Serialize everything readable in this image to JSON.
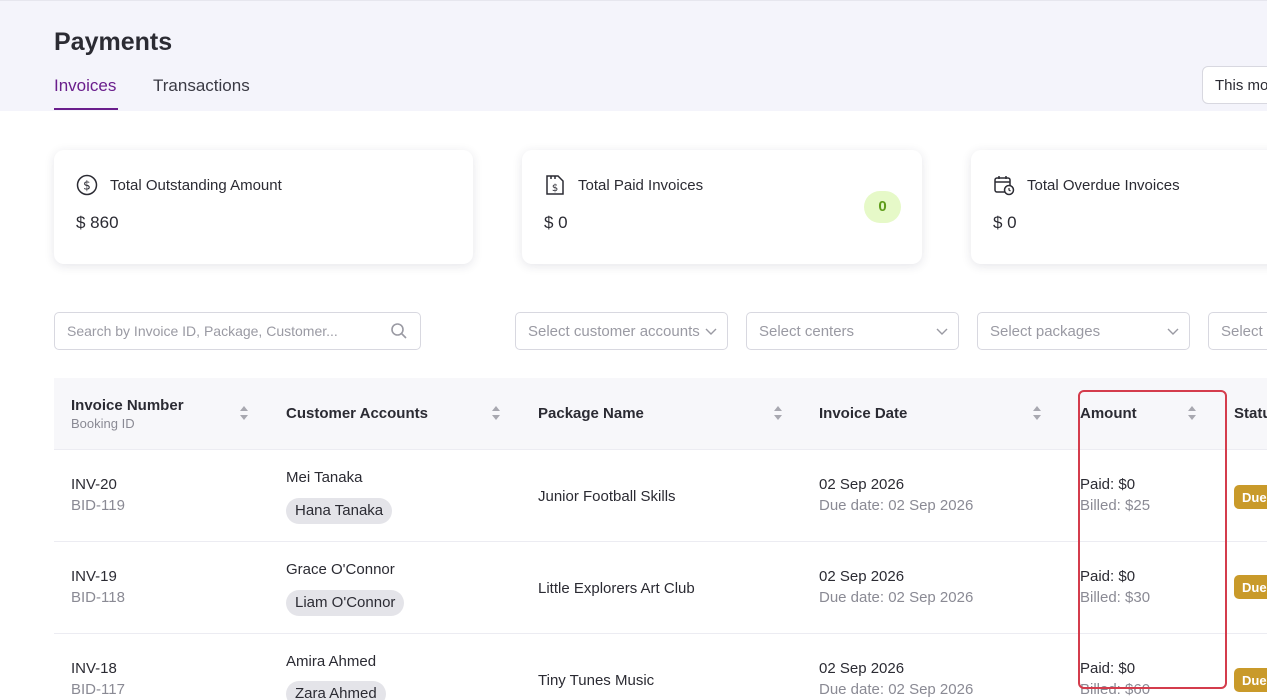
{
  "header": {
    "title": "Payments",
    "tabs": [
      {
        "label": "Invoices",
        "active": true
      },
      {
        "label": "Transactions",
        "active": false
      }
    ],
    "period_select": "This mo"
  },
  "cards": [
    {
      "label": "Total Outstanding Amount",
      "value": "$ 860",
      "icon": "dollar-circle-icon"
    },
    {
      "label": "Total Paid Invoices",
      "value": "$ 0",
      "badge": "0",
      "icon": "paid-invoice-icon"
    },
    {
      "label": "Total Overdue Invoices",
      "value": "$ 0",
      "icon": "calendar-clock-icon"
    }
  ],
  "filters": {
    "search_placeholder": "Search by Invoice ID, Package, Customer...",
    "customer_accounts": "Select customer accounts",
    "centers": "Select centers",
    "packages": "Select packages",
    "fourth": "Select"
  },
  "table": {
    "headers": {
      "invoice_number": "Invoice Number",
      "booking_id": "Booking ID",
      "customer_accounts": "Customer Accounts",
      "package_name": "Package Name",
      "invoice_date": "Invoice Date",
      "amount": "Amount",
      "status": "Statu"
    },
    "rows": [
      {
        "invoice": "INV-20",
        "booking": "BID-119",
        "customer": "Mei Tanaka",
        "child": "Hana Tanaka",
        "package": "Junior Football Skills",
        "date": "02 Sep 2026",
        "due": "Due date: 02 Sep 2026",
        "paid": "Paid: $0",
        "billed": "Billed: $25",
        "status": "Due"
      },
      {
        "invoice": "INV-19",
        "booking": "BID-118",
        "customer": "Grace O'Connor",
        "child": "Liam O'Connor",
        "package": "Little Explorers Art Club",
        "date": "02 Sep 2026",
        "due": "Due date: 02 Sep 2026",
        "paid": "Paid: $0",
        "billed": "Billed: $30",
        "status": "Due"
      },
      {
        "invoice": "INV-18",
        "booking": "BID-117",
        "customer": "Amira Ahmed",
        "child": "Zara Ahmed",
        "package": "Tiny Tunes Music",
        "date": "02 Sep 2026",
        "due": "Due date: 02 Sep 2026",
        "paid": "Paid: $0",
        "billed": "Billed: $60",
        "status": "Due"
      }
    ]
  },
  "colors": {
    "accent": "#6a1e8c",
    "status_due": "#c99a2a",
    "highlight": "#d43c4c",
    "badge_bg": "#e6f9c8"
  }
}
